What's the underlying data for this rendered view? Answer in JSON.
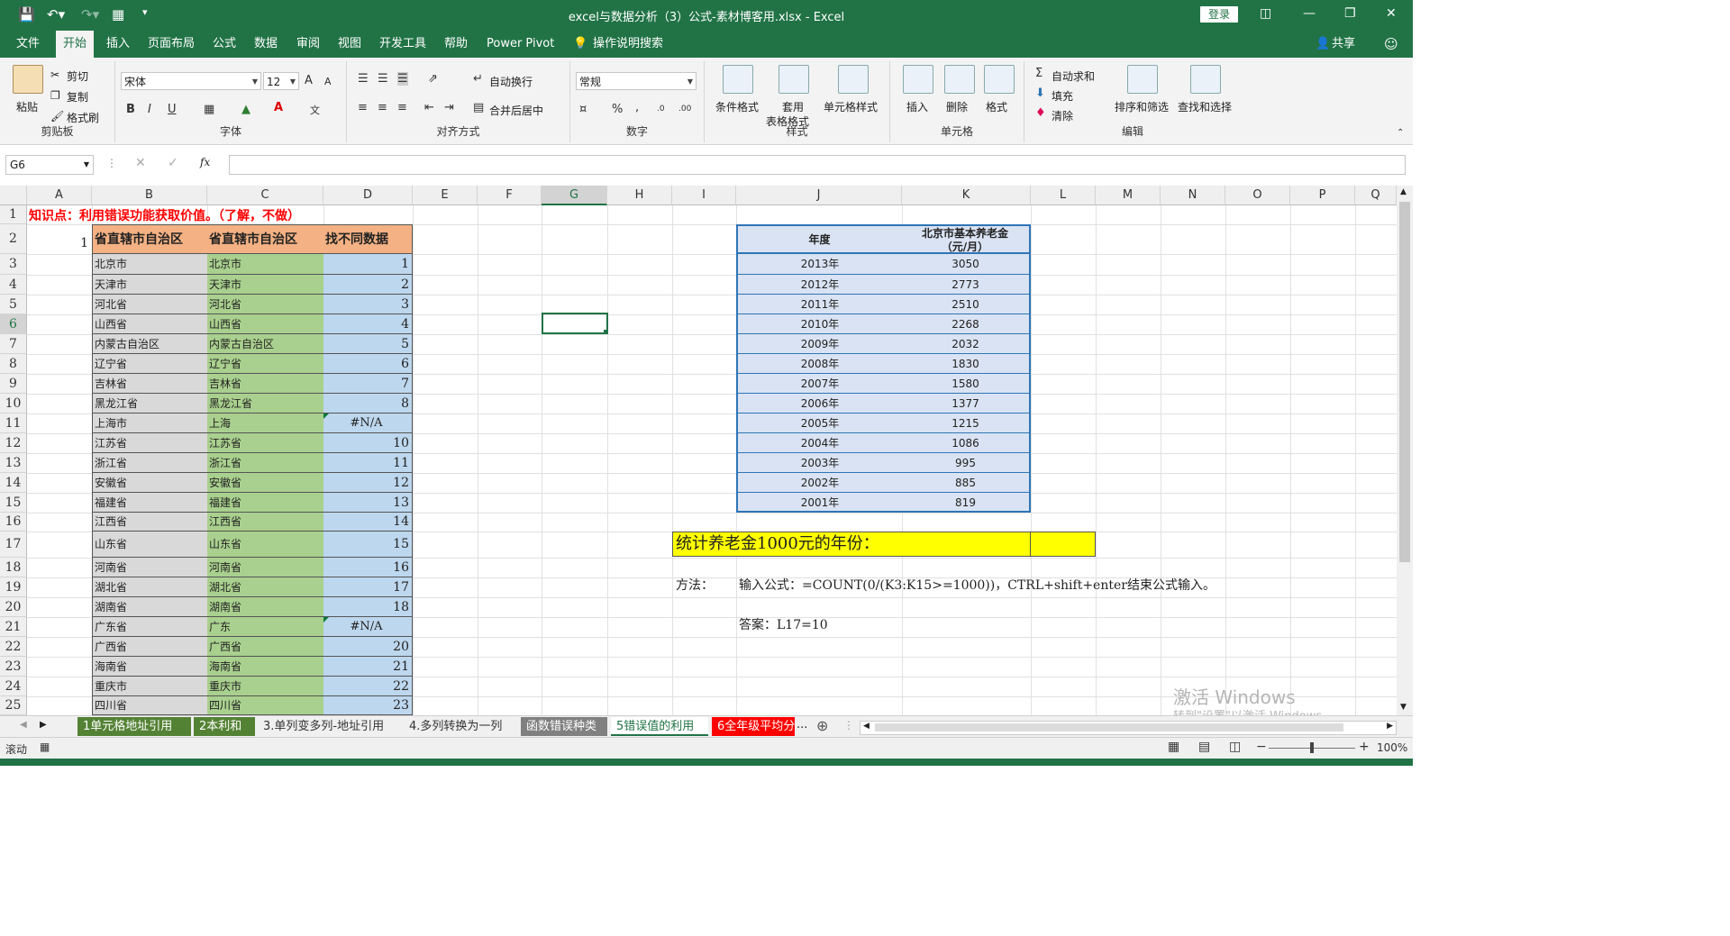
{
  "window": {
    "title": "excel与数据分析（3）公式-素材博客用.xlsx  -  Excel",
    "login_label": "登录"
  },
  "ribbon_tabs": [
    "文件",
    "开始",
    "插入",
    "页面布局",
    "公式",
    "数据",
    "审阅",
    "视图",
    "开发工具",
    "帮助",
    "Power Pivot"
  ],
  "ribbon_tab_active": "开始",
  "tell_me": "操作说明搜索",
  "share": "共享",
  "ribbon": {
    "clipboard": {
      "paste": "粘贴",
      "cut": "剪切",
      "copy": "复制",
      "format_painter": "格式刷",
      "label": "剪贴板"
    },
    "font": {
      "name": "宋体",
      "size": "12",
      "label": "字体",
      "bold": "B",
      "italic": "I",
      "underline": "U",
      "grow": "A",
      "shrink": "A"
    },
    "alignment": {
      "wrap": "自动换行",
      "merge": "合并后居中",
      "label": "对齐方式"
    },
    "number": {
      "format": "常规",
      "label": "数字",
      "percent": "%",
      "comma": ","
    },
    "styles": {
      "conditional": "条件格式",
      "table_line1": "套用",
      "table_line2": "表格格式",
      "cell_styles": "单元格样式",
      "label": "样式"
    },
    "cells": {
      "insert": "插入",
      "delete": "删除",
      "format": "格式",
      "label": "单元格"
    },
    "editing": {
      "autosum": "自动求和",
      "fill": "填充",
      "clear": "清除",
      "sort": "排序和筛选",
      "find": "查找和选择",
      "label": "编辑"
    }
  },
  "formula_bar": {
    "name_box": "G6",
    "fx": "fx",
    "formula": ""
  },
  "columns": [
    "A",
    "B",
    "C",
    "D",
    "E",
    "F",
    "G",
    "H",
    "I",
    "J",
    "K",
    "L",
    "M",
    "N",
    "O",
    "P",
    "Q"
  ],
  "selected_column": "G",
  "rows": [
    "1",
    "2",
    "3",
    "4",
    "5",
    "6",
    "7",
    "8",
    "9",
    "10",
    "11",
    "12",
    "13",
    "14",
    "15",
    "16",
    "17",
    "18",
    "19",
    "20",
    "21",
    "22",
    "23",
    "24",
    "25"
  ],
  "selected_row": "6",
  "sheet": {
    "title_note": "知识点：利用错误功能获取价值。（了解，不做）",
    "a2": "1",
    "header_b": "省直辖市自治区",
    "header_c": "省直辖市自治区",
    "header_d": "找不同数据",
    "list": [
      {
        "b": "北京市",
        "c": "北京市",
        "d": "1"
      },
      {
        "b": "天津市",
        "c": "天津市",
        "d": "2"
      },
      {
        "b": "河北省",
        "c": "河北省",
        "d": "3"
      },
      {
        "b": "山西省",
        "c": "山西省",
        "d": "4"
      },
      {
        "b": "内蒙古自治区",
        "c": "内蒙古自治区",
        "d": "5"
      },
      {
        "b": "辽宁省",
        "c": "辽宁省",
        "d": "6"
      },
      {
        "b": "吉林省",
        "c": "吉林省",
        "d": "7"
      },
      {
        "b": "黑龙江省",
        "c": "黑龙江省",
        "d": "8"
      },
      {
        "b": "上海市",
        "c": "上海",
        "d": "#N/A"
      },
      {
        "b": "江苏省",
        "c": "江苏省",
        "d": "10"
      },
      {
        "b": "浙江省",
        "c": "浙江省",
        "d": "11"
      },
      {
        "b": "安徽省",
        "c": "安徽省",
        "d": "12"
      },
      {
        "b": "福建省",
        "c": "福建省",
        "d": "13"
      },
      {
        "b": "江西省",
        "c": "江西省",
        "d": "14"
      },
      {
        "b": "山东省",
        "c": "山东省",
        "d": "15"
      },
      {
        "b": "河南省",
        "c": "河南省",
        "d": "16"
      },
      {
        "b": "湖北省",
        "c": "湖北省",
        "d": "17"
      },
      {
        "b": "湖南省",
        "c": "湖南省",
        "d": "18"
      },
      {
        "b": "广东省",
        "c": "广东",
        "d": "#N/A"
      },
      {
        "b": "广西省",
        "c": "广西省",
        "d": "20"
      },
      {
        "b": "海南省",
        "c": "海南省",
        "d": "21"
      },
      {
        "b": "重庆市",
        "c": "重庆市",
        "d": "22"
      },
      {
        "b": "四川省",
        "c": "四川省",
        "d": "23"
      }
    ],
    "pension_header_year": "年度",
    "pension_header_amount_l1": "北京市基本养老金",
    "pension_header_amount_l2": "（元/月）",
    "pension": [
      {
        "year": "2013年",
        "amount": "3050"
      },
      {
        "year": "2012年",
        "amount": "2773"
      },
      {
        "year": "2011年",
        "amount": "2510"
      },
      {
        "year": "2010年",
        "amount": "2268"
      },
      {
        "year": "2009年",
        "amount": "2032"
      },
      {
        "year": "2008年",
        "amount": "1830"
      },
      {
        "year": "2007年",
        "amount": "1580"
      },
      {
        "year": "2006年",
        "amount": "1377"
      },
      {
        "year": "2005年",
        "amount": "1215"
      },
      {
        "year": "2004年",
        "amount": "1086"
      },
      {
        "year": "2003年",
        "amount": "995"
      },
      {
        "year": "2002年",
        "amount": "885"
      },
      {
        "year": "2001年",
        "amount": "819"
      }
    ],
    "question": "统计养老金1000元的年份：",
    "method_label": "方法：",
    "method_text": "输入公式：=COUNT(0/(K3:K15>=1000))，CTRL+shift+enter结束公式输入。",
    "answer": "答案：L17=10"
  },
  "sheet_tabs": [
    {
      "label": "1单元格地址引用",
      "bg": "#548235",
      "fg": "#ffffff"
    },
    {
      "label": "2本利和",
      "bg": "#548235",
      "fg": "#ffffff"
    },
    {
      "label": "3.单列变多列-地址引用",
      "bg": "#f0f0f0",
      "fg": "#333333"
    },
    {
      "label": "4.多列转换为一列",
      "bg": "#f0f0f0",
      "fg": "#333333"
    },
    {
      "label": "函数错误种类",
      "bg": "#808080",
      "fg": "#ffffff"
    },
    {
      "label": "5错误值的利用",
      "bg": "#ffffff",
      "fg": "#217346"
    },
    {
      "label": "6全年级平均分",
      "bg": "#ff0000",
      "fg": "#ffffff"
    }
  ],
  "sheet_tabs_more": "...",
  "status": {
    "mode": "滚动",
    "zoom": "100%"
  },
  "watermark": {
    "line1": "激活 Windows",
    "line2": "转到\"设置\"以激活 Windows。"
  },
  "colors": {
    "excel_green": "#217346",
    "header_orange": "#f4b183",
    "list_grey": "#d9d9d9",
    "list_green": "#a9d08e",
    "list_blue": "#bdd7ee",
    "table_blue": "#dae3f3",
    "question_yellow": "#ffff00"
  }
}
